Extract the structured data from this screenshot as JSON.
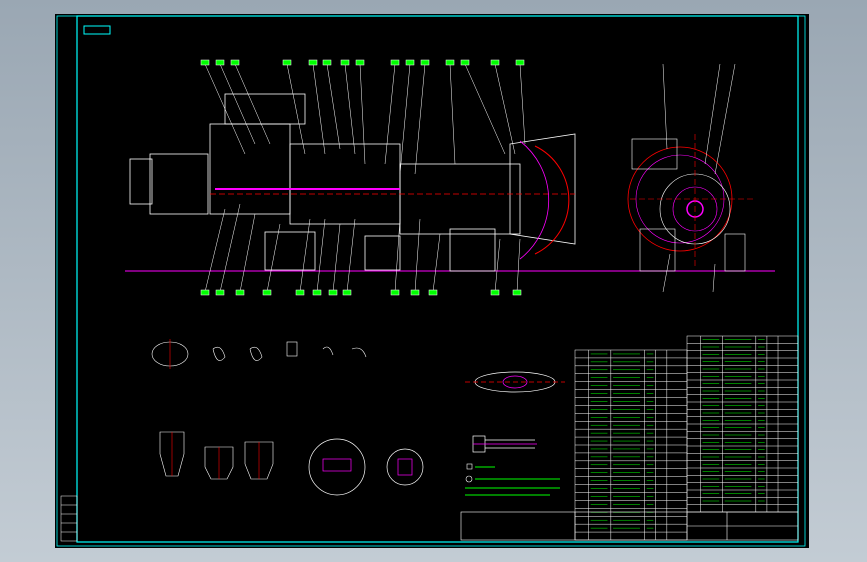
{
  "viewport": {
    "background": "#000000"
  },
  "drawing": {
    "title_tag": "",
    "colors": {
      "border": "#00ffff",
      "line": "#ffffff",
      "label": "#00ff00",
      "center": "#ff0000",
      "accent": "#ff00ff",
      "dim": "#00ffff",
      "yellow": "#ffff00"
    },
    "title_block": {
      "main_title": "",
      "sub_title": ""
    },
    "notes": [
      "",
      "",
      "",
      "",
      ""
    ]
  }
}
